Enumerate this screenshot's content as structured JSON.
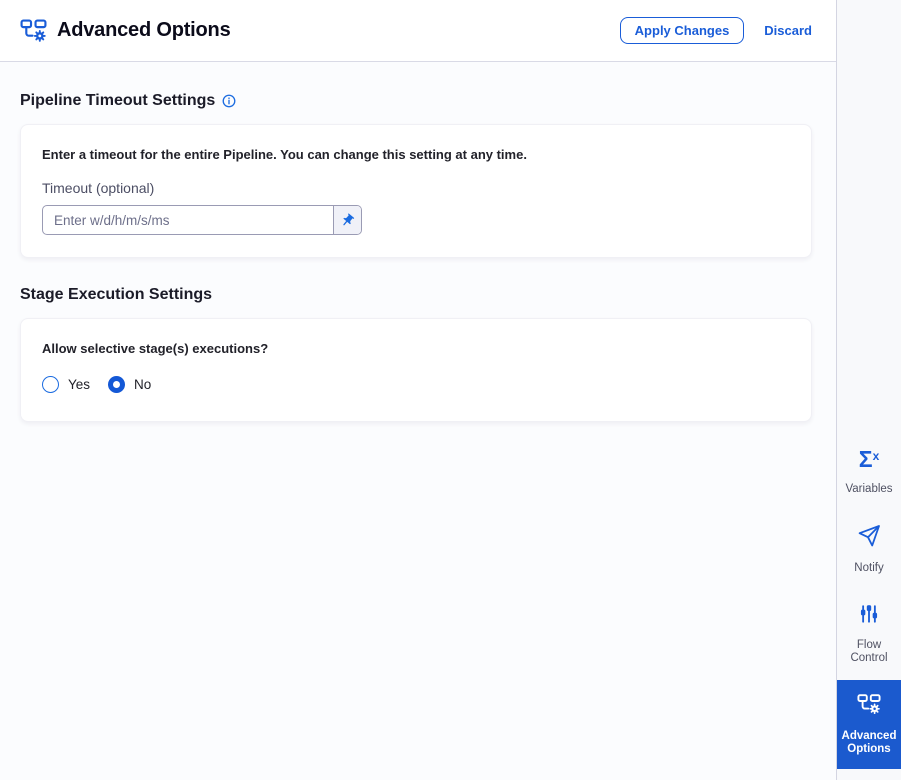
{
  "header": {
    "title": "Advanced Options",
    "apply_label": "Apply Changes",
    "discard_label": "Discard"
  },
  "pipeline_timeout": {
    "heading": "Pipeline Timeout Settings",
    "description": "Enter a timeout for the entire Pipeline. You can change this setting at any time.",
    "timeout_label": "Timeout (optional)",
    "timeout_placeholder": "Enter w/d/h/m/s/ms",
    "timeout_value": ""
  },
  "stage_execution": {
    "heading": "Stage Execution Settings",
    "question": "Allow selective stage(s) executions?",
    "options": [
      {
        "label": "Yes",
        "selected": false
      },
      {
        "label": "No",
        "selected": true
      }
    ]
  },
  "sidebar": {
    "items": [
      {
        "label": "Variables",
        "icon": "sigma-x-icon",
        "selected": false
      },
      {
        "label": "Notify",
        "icon": "paper-plane-icon",
        "selected": false
      },
      {
        "label": "Flow Control",
        "icon": "sliders-icon",
        "selected": false
      },
      {
        "label": "Advanced Options",
        "icon": "pipeline-gear-icon",
        "selected": true
      }
    ],
    "sigma_glyph": "Σ",
    "sigma_sup": "x"
  },
  "colors": {
    "accent_blue": "#1a5dd8",
    "selected_item_bg": "#1b5ace",
    "content_bg": "#fbfcfe",
    "sidebar_bg": "#f8f9fb"
  }
}
